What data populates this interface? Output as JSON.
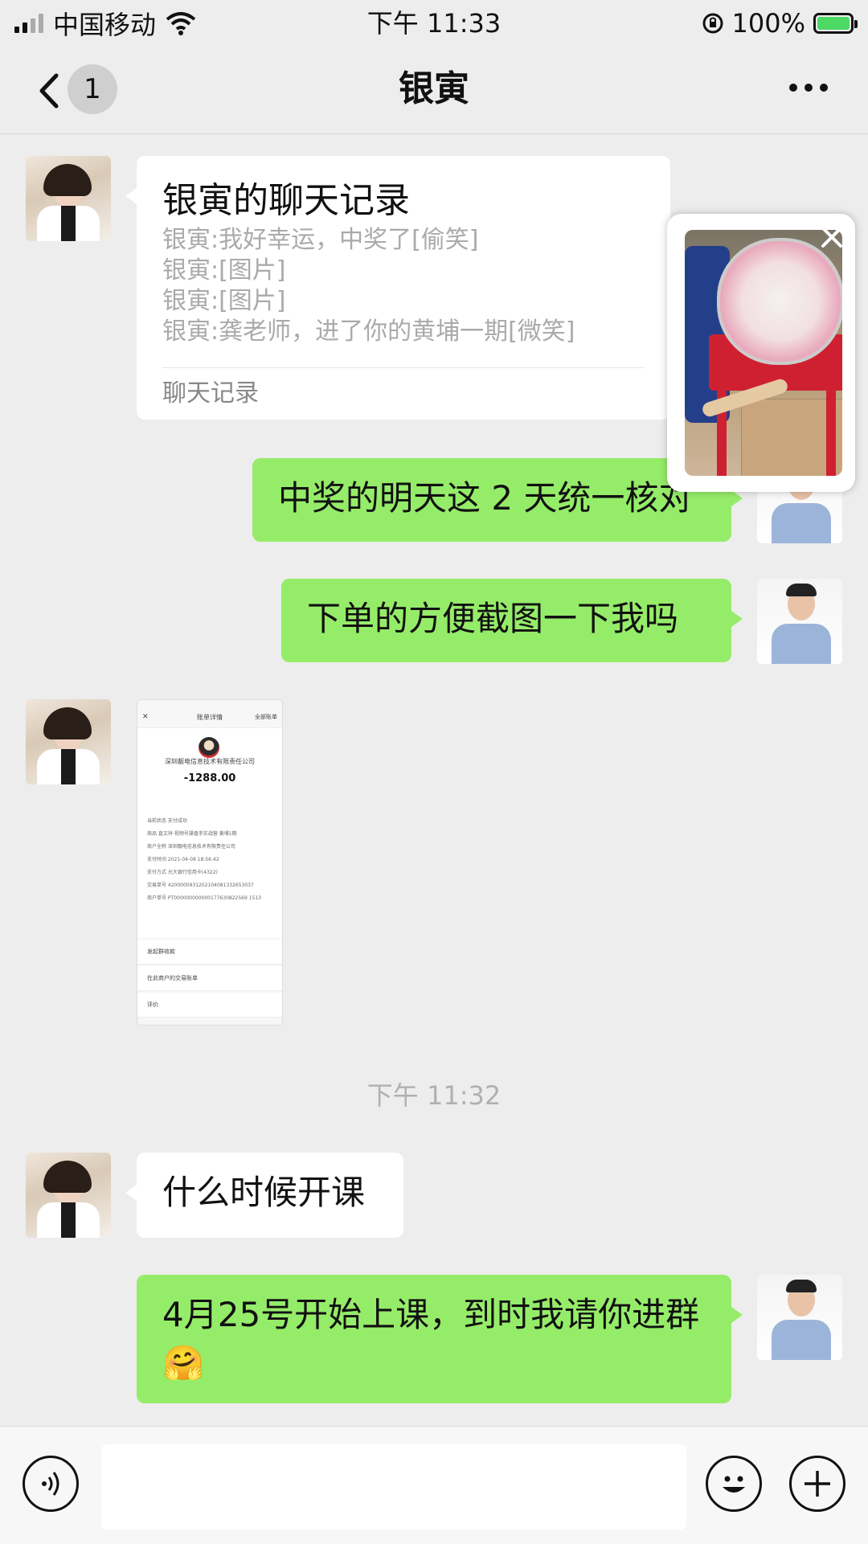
{
  "status_bar": {
    "carrier": "中国移动",
    "time": "下午 11:33",
    "battery": "100%"
  },
  "nav": {
    "unread_count": "1",
    "title": "银寅"
  },
  "messages": {
    "chat_record": {
      "title": "银寅的聊天记录",
      "lines": [
        "银寅:我好幸运，中奖了[偷笑]",
        "银寅:[图片]",
        "银寅:[图片]",
        "银寅:龚老师，进了你的黄埔一期[微笑]"
      ],
      "footer": "聊天记录"
    },
    "sent_1": "中奖的明天这 2 天统一核对",
    "sent_2": "下单的方便截图一下我吗",
    "receipt_image": {
      "title": "账单详情",
      "all_bills": "全部账单",
      "company": "深圳靓电信息技术有限责任公司",
      "amount": "-1288.00",
      "rows": [
        "当前状态   支付成功",
        "商品   直文祥·视频号操盘手实战营 黄埔1期",
        "商户全称   深圳靓电信息技术有限责任公司",
        "支付时间   2021-04-08 18:56:42",
        "支付方式   光大银行信用卡(4322)",
        "交易单号   4200000931202104081332653037",
        "商户单号   PT000000000000177630822569 1513"
      ],
      "menu": [
        "发起群收款",
        "在此商户的交易账单",
        "评价"
      ]
    },
    "time_separator": "下午 11:32",
    "received_2": "什么时候开课",
    "sent_3": "4月25号开始上课，到时我请你进群🤗"
  },
  "icons": {
    "back": "chevron-left-icon",
    "more": "ellipsis-icon",
    "voice": "voice-icon",
    "emoji": "smiley-icon",
    "plus": "plus-icon",
    "close": "close-icon"
  },
  "colors": {
    "background": "#ededed",
    "sent_bubble": "#95ec69",
    "received_bubble": "#ffffff",
    "battery_fill": "#4cd964"
  }
}
